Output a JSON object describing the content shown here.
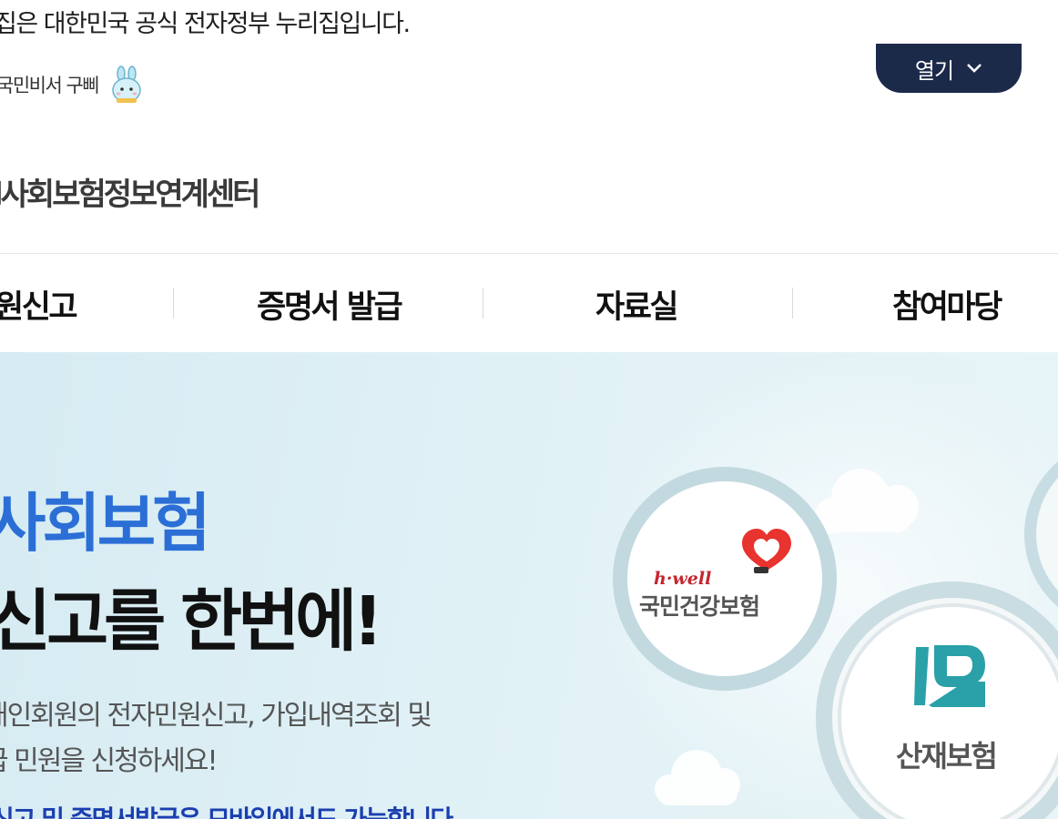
{
  "banner": {
    "notice": "집은 대한민국 공식 전자정부 누리집입니다.",
    "assistant_label": "국민비서 구삐",
    "open_button": "열기"
  },
  "site": {
    "name": "l사회보험정보연계센터"
  },
  "nav": {
    "items": [
      {
        "label": "원신고"
      },
      {
        "label": "증명서 발급"
      },
      {
        "label": "자료실"
      },
      {
        "label": "참여마당"
      }
    ]
  },
  "hero": {
    "title_line1": "사회보험",
    "title_line2": "신고를 한번에!",
    "desc_line1": "개인회원의 전자민원신고, 가입내역조회 및",
    "desc_line2": "급 민원을 신청하세요!",
    "note": "신고 및 증명서발급은 모바일에서도 가능합니다"
  },
  "cards": [
    {
      "brand": "h·well",
      "name": "국민건강보험"
    },
    {
      "name": "산재보험"
    }
  ],
  "colors": {
    "accent": "#2b6fd6",
    "navy": "#1c2a4a",
    "hero_bg": "#dff0f5"
  }
}
